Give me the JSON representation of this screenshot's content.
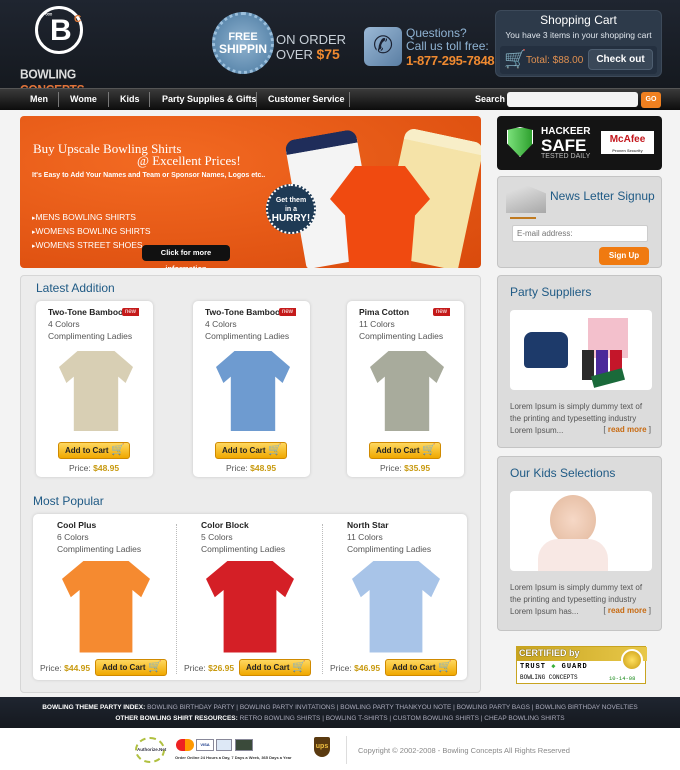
{
  "header": {
    "logo": {
      "dots": "°°°",
      "letter": "B",
      "sup": "C",
      "word1": "BOWLING",
      "word2": "CONCEPTS"
    },
    "shipping": {
      "line1": "FREE",
      "line2": "SHIPPIN",
      "on_order": "ON ORDER",
      "over": "OVER",
      "amount": "$75"
    },
    "phone": {
      "q1": "Questions?",
      "q2": "Call us toll free:",
      "number": "1-877-295-7848"
    },
    "cart": {
      "title": "Shopping Cart",
      "subtitle": "You have 3 items in your shopping cart",
      "total": "Total: $88.00",
      "checkout_label": "Check out"
    }
  },
  "nav": {
    "items": [
      {
        "label": "Men"
      },
      {
        "label": "Wome"
      },
      {
        "label": "Kids"
      },
      {
        "label": "Party Supplies & Gifts"
      },
      {
        "label": "Customer Service"
      }
    ],
    "search_label": "Search",
    "search_value": "",
    "go_label": "GO"
  },
  "banner": {
    "headline1": "Buy Upscale Bowling Shirts",
    "headline2": "@ Excellent Prices!",
    "subline": "It's Easy to Add Your Names and Team or Sponsor Names, Logos etc..",
    "links": [
      "MENS BOWLING SHIRTS",
      "WOMENS BOWLING SHIRTS",
      "WOMENS STREET SHOES"
    ],
    "cta": "Click for more information",
    "badge": {
      "l1": "Get them",
      "l2": "in a",
      "l3": "HURRY!"
    }
  },
  "latest": {
    "title": "Latest Addition",
    "products": [
      {
        "name": "Two-Tone Bamboo",
        "badge": "new",
        "colors": "4 Colors",
        "note": "Complimenting Ladies",
        "cart_label": "Add to Cart",
        "price_label": "Price:",
        "price": "$48.95",
        "shirt_color": "#d8cfb4"
      },
      {
        "name": "Two-Tone Bamboo",
        "badge": "new",
        "colors": "4 Colors",
        "note": "Complimenting Ladies",
        "cart_label": "Add to Cart",
        "price_label": "Price:",
        "price": "$48.95",
        "shirt_color": "#6e9bd0"
      },
      {
        "name": "Pima Cotton",
        "badge": "new",
        "colors": "11 Colors",
        "note": "Complimenting Ladies",
        "cart_label": "Add to Cart",
        "price_label": "Price:",
        "price": "$35.95",
        "shirt_color": "#a8ab9c"
      }
    ]
  },
  "popular": {
    "title": "Most Popular",
    "products": [
      {
        "name": "Cool Plus",
        "colors": "6 Colors",
        "note": "Complimenting Ladies",
        "cart_label": "Add to Cart",
        "price_label": "Price:",
        "price": "$44.95",
        "shirt_color": "#f58a30"
      },
      {
        "name": "Color Block",
        "colors": "5 Colors",
        "note": "Complimenting Ladies",
        "cart_label": "Add to Cart",
        "price_label": "Price:",
        "price": "$26.95",
        "shirt_color": "#d41f26"
      },
      {
        "name": "North Star",
        "colors": "11 Colors",
        "note": "Complimenting Ladies",
        "cart_label": "Add to Cart",
        "price_label": "Price:",
        "price": "$46.95",
        "shirt_color": "#a8c4e8"
      }
    ]
  },
  "sidebar": {
    "security": {
      "l1": "HACKEER",
      "l2": "SAFE",
      "l3": "TESTED DAILY",
      "brand": "McAfee",
      "brand_sub": "Proven Security"
    },
    "newsletter": {
      "title": "News Letter Signup",
      "email_placeholder": "E-mail address:",
      "signup_label": "Sign Up"
    },
    "party": {
      "title": "Party Suppliers",
      "text": "Lorem Ipsum is simply dummy text of the printing and typesetting industry Lorem Ipsum...",
      "read_more": "read more"
    },
    "kids": {
      "title": "Our Kids Selections",
      "text": "Lorem Ipsum is simply dummy text of the printing and typesetting industry Lorem Ipsum has...",
      "read_more": "read more"
    },
    "trust": {
      "certified": "CERTIFIED by",
      "tg1": "TRUST",
      "tg2": "GUARD",
      "name": "BOWLING CONCEPTS",
      "date": "10-14-08"
    }
  },
  "footer": {
    "index_label": "BOWLING THEME PARTY INDEX:",
    "index_links": [
      "BOWLING BIRTHDAY PARTY",
      "BOWLING PARTY INVITATIONS",
      "BOWLING PARTY THANKYOU NOTE",
      "BOWLING PARTY BAGS",
      "BOWLING BIRTHDAY NOVELTIES"
    ],
    "resources_label": "OTHER BOWLING SHIRT RESOURCES:",
    "resources_links": [
      "RETRO BOWLING SHIRTS",
      "BOWLING T-SHIRTS",
      "CUSTOM BOWLING SHIRTS",
      "CHEAP BOWLING SHIRTS"
    ],
    "authnet": "Authorize.Net",
    "cards": [
      "MC",
      "VISA",
      "AMEX",
      "DISC"
    ],
    "order_text": "Order Online 24 Hours a Day, 7 Days a Week, 365 Days a Year",
    "ups": "ups",
    "copyright": "Copyright © 2002-2008 - Bowling Concepts  All Rights Reserved"
  }
}
